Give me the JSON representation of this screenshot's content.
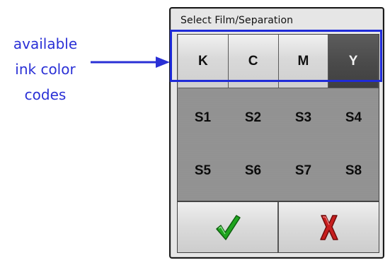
{
  "annotation": {
    "lines": [
      "available",
      "ink color",
      "codes"
    ],
    "color": "#2a30d6"
  },
  "dialog": {
    "title": "Select Film/Separation"
  },
  "ink_buttons": [
    {
      "label": "K",
      "selected": false
    },
    {
      "label": "C",
      "selected": false
    },
    {
      "label": "M",
      "selected": false
    },
    {
      "label": "Y",
      "selected": true
    }
  ],
  "separation_rows": [
    [
      "S1",
      "S2",
      "S3",
      "S4"
    ],
    [
      "S5",
      "S6",
      "S7",
      "S8"
    ]
  ],
  "actions": {
    "ok_icon": "checkmark-icon",
    "cancel_icon": "x-icon",
    "ok_color": "#1fa51f",
    "cancel_color": "#c81e1e"
  },
  "highlight_color": "#1f2bd8"
}
